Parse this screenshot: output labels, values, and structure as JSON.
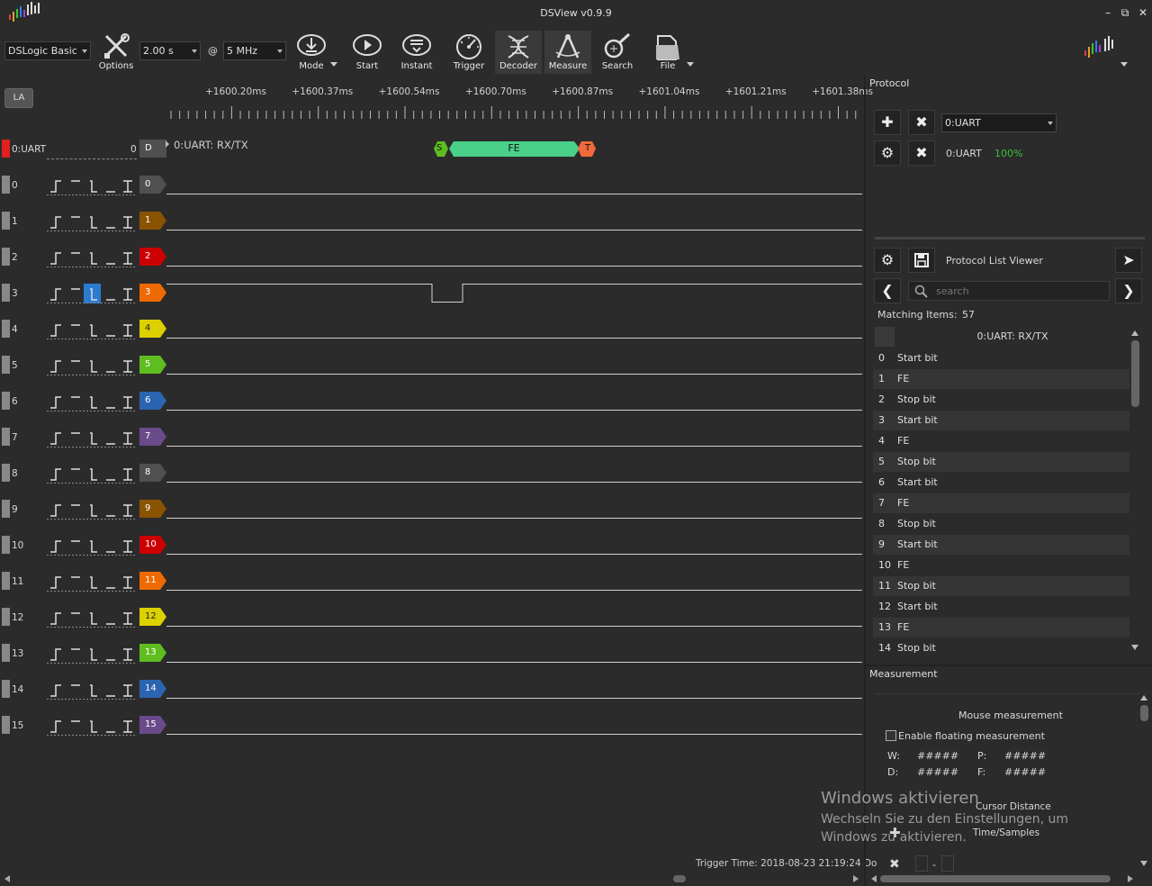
{
  "window": {
    "title": "DSView v0.9.9",
    "minimize": "–",
    "restore": "⧉",
    "close": "✕"
  },
  "toolbar": {
    "device": "DSLogic Basic",
    "duration": "2.00 s",
    "at": "@",
    "rate": "5 MHz",
    "options_label": "Options",
    "mode_label": "Mode",
    "start_label": "Start",
    "instant_label": "Instant",
    "trigger_label": "Trigger",
    "decoder_label": "Decoder",
    "measure_label": "Measure",
    "search_label": "Search",
    "file_label": "File"
  },
  "la_button": "LA",
  "ruler": [
    "+1600.20ms",
    "+1600.37ms",
    "+1600.54ms",
    "+1600.70ms",
    "+1600.87ms",
    "+1601.04ms",
    "+1601.21ms",
    "+1601.38ms"
  ],
  "decoder_row": {
    "name": "0:UART",
    "count": "0",
    "tag": "D",
    "title": "0:UART: RX/TX",
    "start_marker": "S",
    "frame_label": "FE",
    "stop_marker": "T"
  },
  "channels": [
    "0",
    "1",
    "2",
    "3",
    "4",
    "5",
    "6",
    "7",
    "8",
    "9",
    "10",
    "11",
    "12",
    "13",
    "14",
    "15"
  ],
  "colors": {
    "ch_tags": [
      "#505050",
      "#8a5300",
      "#cc0000",
      "#ee6a00",
      "#ddd000",
      "#5fbd1f",
      "#2b64b0",
      "#6a4a8a",
      "#505050",
      "#8a5300",
      "#cc0000",
      "#ee6a00",
      "#ddd000",
      "#5fbd1f",
      "#2b64b0",
      "#6a4a8a"
    ],
    "frame": "#4bd08a",
    "start": "#5fbd1f",
    "stop": "#ee6a3a",
    "trigger_highlight": "#2b7bd0"
  },
  "protocol": {
    "title": "Protocol",
    "selected": "0:UART",
    "decoder_name": "0:UART",
    "progress": "100%"
  },
  "list_viewer": {
    "title": "Protocol List Viewer",
    "search_placeholder": "search",
    "matching_label": "Matching Items:",
    "matching_count": "57",
    "column": "0:UART: RX/TX",
    "rows": [
      {
        "i": "0",
        "t": "Start bit"
      },
      {
        "i": "1",
        "t": "FE"
      },
      {
        "i": "2",
        "t": "Stop bit"
      },
      {
        "i": "3",
        "t": "Start bit"
      },
      {
        "i": "4",
        "t": "FE"
      },
      {
        "i": "5",
        "t": "Stop bit"
      },
      {
        "i": "6",
        "t": "Start bit"
      },
      {
        "i": "7",
        "t": "FE"
      },
      {
        "i": "8",
        "t": "Stop bit"
      },
      {
        "i": "9",
        "t": "Start bit"
      },
      {
        "i": "10",
        "t": "FE"
      },
      {
        "i": "11",
        "t": "Stop bit"
      },
      {
        "i": "12",
        "t": "Start bit"
      },
      {
        "i": "13",
        "t": "FE"
      },
      {
        "i": "14",
        "t": "Stop bit"
      }
    ]
  },
  "measurement": {
    "title": "Measurement",
    "mouse_title": "Mouse measurement",
    "enable_label": "Enable floating measurement",
    "w_label": "W:",
    "w_value": "#####",
    "p_label": "P:",
    "p_value": "#####",
    "d_label": "D:",
    "d_value": "#####",
    "f_label": "F:",
    "f_value": "#####",
    "cursor_title": "Cursor Distance",
    "time_samples": "Time/Samples",
    "dash": "-"
  },
  "status": {
    "trigger_time": "Trigger Time: 2018-08-23 21:19:24 Do"
  },
  "watermark": {
    "line1": "Windows aktivieren",
    "line2": "Wechseln Sie zu den Einstellungen, um Windows zu aktivieren."
  }
}
